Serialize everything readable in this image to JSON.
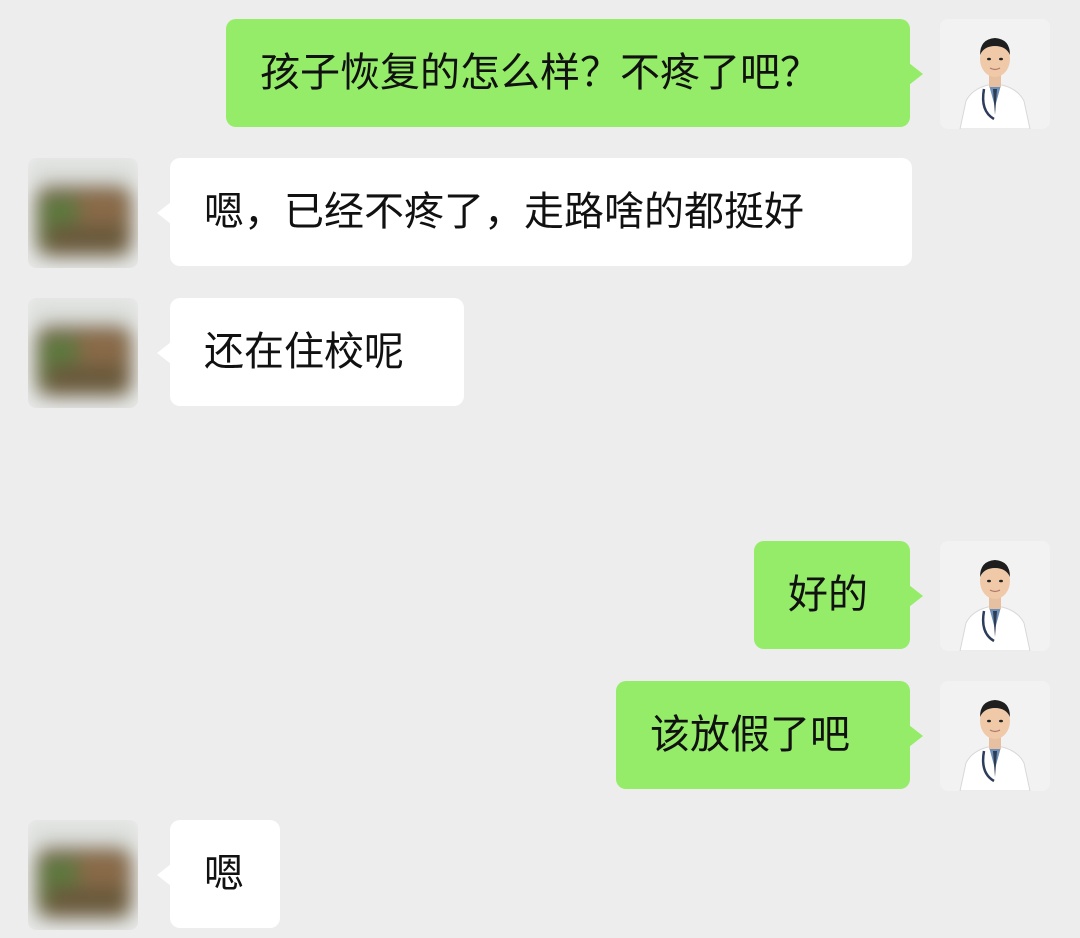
{
  "chat": {
    "colors": {
      "background": "#ededed",
      "self_bubble": "#95ec69",
      "other_bubble": "#ffffff"
    },
    "messages": [
      {
        "sender": "self",
        "text": "孩子恢复的怎么样？不疼了吧？"
      },
      {
        "sender": "other",
        "text": "嗯，已经不疼了，走路啥的都挺好"
      },
      {
        "sender": "other",
        "text": "还在住校呢"
      },
      {
        "sender": "self",
        "text": "好的"
      },
      {
        "sender": "self",
        "text": "该放假了吧"
      },
      {
        "sender": "other",
        "text": "嗯"
      }
    ],
    "avatars": {
      "self": "doctor-avatar",
      "other": "blurred-avatar"
    }
  }
}
